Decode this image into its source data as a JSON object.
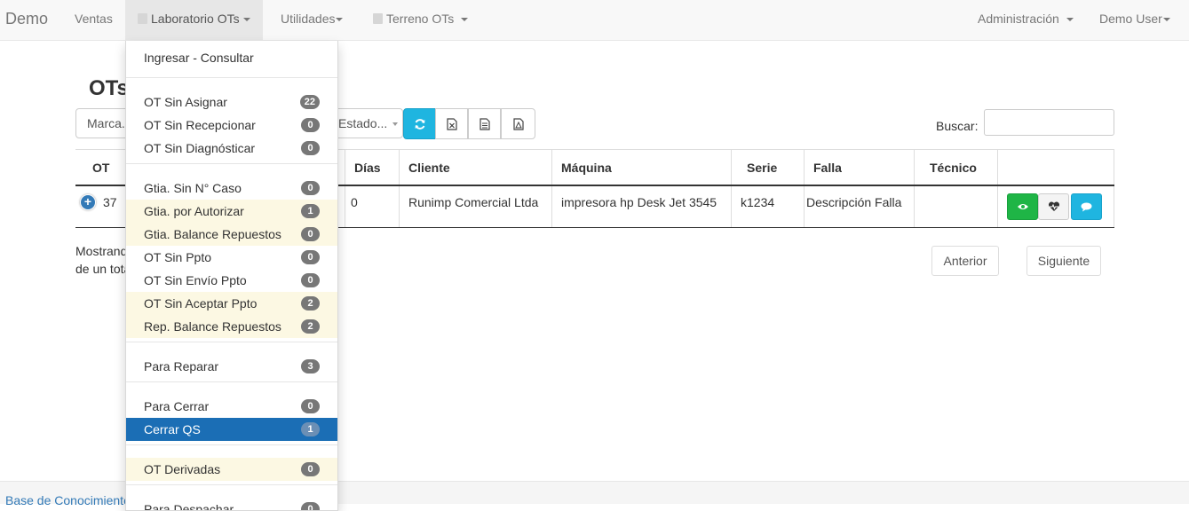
{
  "nav": {
    "brand": "Demo",
    "ventas": "Ventas",
    "laboratorio": "Laboratorio OTs",
    "utilidades": "Utilidades",
    "terreno": "Terreno OTs",
    "administracion": "Administración",
    "user": "Demo User"
  },
  "page": {
    "title": "OTs",
    "marca_select": "Marca...",
    "estado_select": "Estado...",
    "search_label": "Buscar:",
    "search_value": ""
  },
  "toolbar_icons": [
    "refresh-icon",
    "excel-file-icon",
    "document-icon",
    "pdf-file-icon"
  ],
  "table": {
    "headers": {
      "ot": "OT",
      "dias": "Días",
      "cliente": "Cliente",
      "maquina": "Máquina",
      "serie": "Serie",
      "falla": "Falla",
      "tecnico": "Técnico"
    },
    "rows": [
      {
        "ot": "37",
        "dias": "0",
        "cliente": "Runimp Comercial Ltda",
        "maquina": "impresora hp Desk Jet 3545",
        "serie": "k1234",
        "falla": "Descripción Falla",
        "tecnico": ""
      }
    ]
  },
  "footer_info": {
    "line1": "Mostrando",
    "line2": "de un total"
  },
  "pagination": {
    "prev": "Anterior",
    "next": "Siguiente"
  },
  "footer": {
    "link": "Base de Conocimiento"
  },
  "dropdown": {
    "ingresar": "Ingresar - Consultar",
    "groups": [
      [
        {
          "label": "OT Sin Asignar",
          "count": "22",
          "highlight": false
        },
        {
          "label": "OT Sin Recepcionar",
          "count": "0",
          "highlight": false
        },
        {
          "label": "OT Sin Diagnósticar",
          "count": "0",
          "highlight": false
        }
      ],
      [
        {
          "label": "Gtia. Sin N° Caso",
          "count": "0",
          "highlight": false
        },
        {
          "label": "Gtia. por Autorizar",
          "count": "1",
          "highlight": true
        },
        {
          "label": "Gtia. Balance Repuestos",
          "count": "0",
          "highlight": true
        },
        {
          "label": "OT Sin Ppto",
          "count": "0",
          "highlight": false
        },
        {
          "label": "OT Sin Envío Ppto",
          "count": "0",
          "highlight": false
        },
        {
          "label": "OT Sin Aceptar Ppto",
          "count": "2",
          "highlight": true
        },
        {
          "label": "Rep. Balance Repuestos",
          "count": "2",
          "highlight": true
        }
      ],
      [
        {
          "label": "Para Reparar",
          "count": "3",
          "highlight": false
        }
      ],
      [
        {
          "label": "Para Cerrar",
          "count": "0",
          "highlight": false
        },
        {
          "label": "Cerrar QS",
          "count": "1",
          "highlight": false,
          "selected": true
        }
      ],
      [
        {
          "label": "OT Derivadas",
          "count": "0",
          "highlight": true
        }
      ],
      [
        {
          "label": "Para Despachar",
          "count": "0",
          "highlight": false
        }
      ]
    ]
  },
  "colors": {
    "primary": "#1fb5e0",
    "success": "#1fb546",
    "info": "#1fb5e0",
    "selected": "#1b6eb5",
    "highlight": "#fcf8e3",
    "badge": "#777777"
  }
}
